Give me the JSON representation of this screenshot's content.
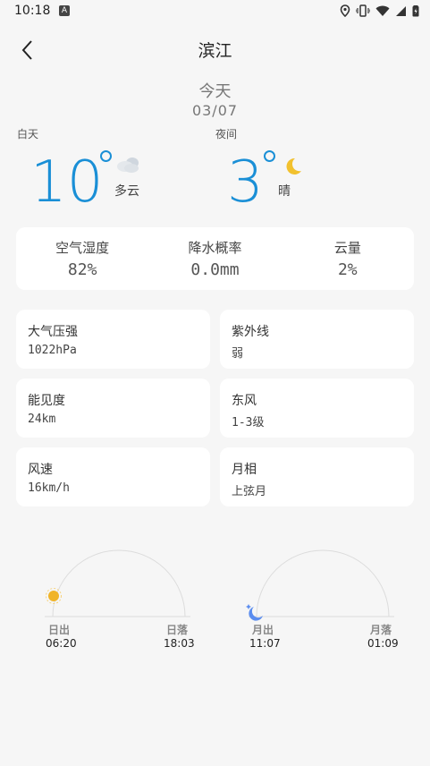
{
  "status": {
    "time": "10:18",
    "a_badge": "A"
  },
  "header": {
    "title": "滨江"
  },
  "today": {
    "label": "今天",
    "date": "03/07"
  },
  "day": {
    "tag": "白天",
    "temp": "10",
    "condition": "多云",
    "icon": "cloudy-icon"
  },
  "night": {
    "tag": "夜间",
    "temp": "3",
    "condition": "晴",
    "icon": "moon-icon"
  },
  "summary": [
    {
      "label": "空气湿度",
      "value": "82%"
    },
    {
      "label": "降水概率",
      "value": "0.0mm"
    },
    {
      "label": "云量",
      "value": "2%"
    }
  ],
  "details": [
    {
      "label": "大气压强",
      "value": "1022hPa"
    },
    {
      "label": "紫外线",
      "value": "弱"
    },
    {
      "label": "能见度",
      "value": "24km"
    },
    {
      "label": "东风",
      "value": "1-3级"
    },
    {
      "label": "风速",
      "value": "16km/h"
    },
    {
      "label": "月相",
      "value": "上弦月"
    }
  ],
  "sun": {
    "rise_label": "日出",
    "set_label": "日落",
    "rise_time": "06:20",
    "set_time": "18:03"
  },
  "moon": {
    "rise_label": "月出",
    "set_label": "月落",
    "rise_time": "11:07",
    "set_time": "01:09"
  },
  "colors": {
    "accent": "#1a8fd6",
    "sun": "#f0b429",
    "moon": "#5b8def"
  }
}
